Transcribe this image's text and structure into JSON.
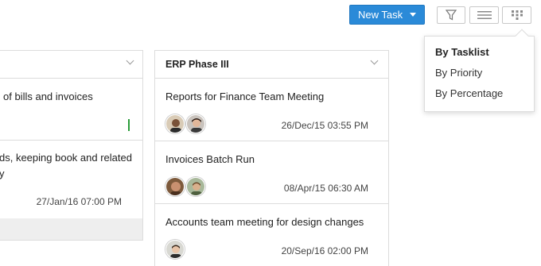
{
  "toolbar": {
    "new_task_label": "New Task"
  },
  "icons": {
    "filter": "filter-icon",
    "list_view": "list-view-icon",
    "grid_view": "grid-view-icon",
    "dropdown_caret": "caret-down-icon",
    "collapse": "chevron-down-icon"
  },
  "colors": {
    "accent": "#2a8ad8",
    "status_green": "#2a9d3a"
  },
  "group_menu": {
    "items": [
      "By Tasklist",
      "By Priority",
      "By Percentage"
    ],
    "selected": "By Tasklist"
  },
  "column1": {
    "cards": [
      {
        "title": "of bills and invoices",
        "date": ""
      },
      {
        "title": "ds, keeping book and related",
        "title2": "y",
        "date": "27/Jan/16 07:00 PM"
      }
    ]
  },
  "column2": {
    "title": "ERP Phase III",
    "cards": [
      {
        "title": "Reports for Finance Team Meeting",
        "date": "26/Dec/15 03:55 PM"
      },
      {
        "title": "Invoices Batch Run",
        "date": "08/Apr/15 06:30 AM"
      },
      {
        "title": "Accounts team meeting for design changes",
        "date": "20/Sep/16 02:00 PM"
      }
    ]
  }
}
